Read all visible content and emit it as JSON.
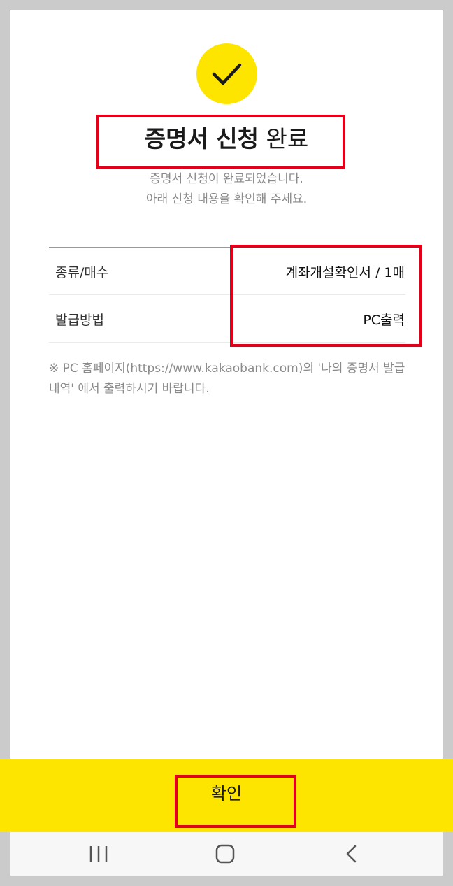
{
  "header": {
    "title_bold": "증명서 신청",
    "title_rest": "완료",
    "subtitle_line1": "증명서 신청이 완료되었습니다.",
    "subtitle_line2": "아래 신청 내용을 확인해 주세요."
  },
  "details": [
    {
      "label": "종류/매수",
      "value": "계좌개설확인서 / 1매"
    },
    {
      "label": "발급방법",
      "value": "PC출력"
    }
  ],
  "note": "※ PC 홈페이지(https://www.kakaobank.com)의 '나의 증명서 발급내역' 에서 출력하시기 바랍니다.",
  "footer": {
    "confirm_label": "확인"
  },
  "icons": {
    "status": "checkmark-icon",
    "nav_recent": "recent-apps-icon",
    "nav_home": "home-icon",
    "nav_back": "back-icon"
  },
  "colors": {
    "accent_yellow": "#fee500",
    "highlight_red": "#e3001b"
  }
}
